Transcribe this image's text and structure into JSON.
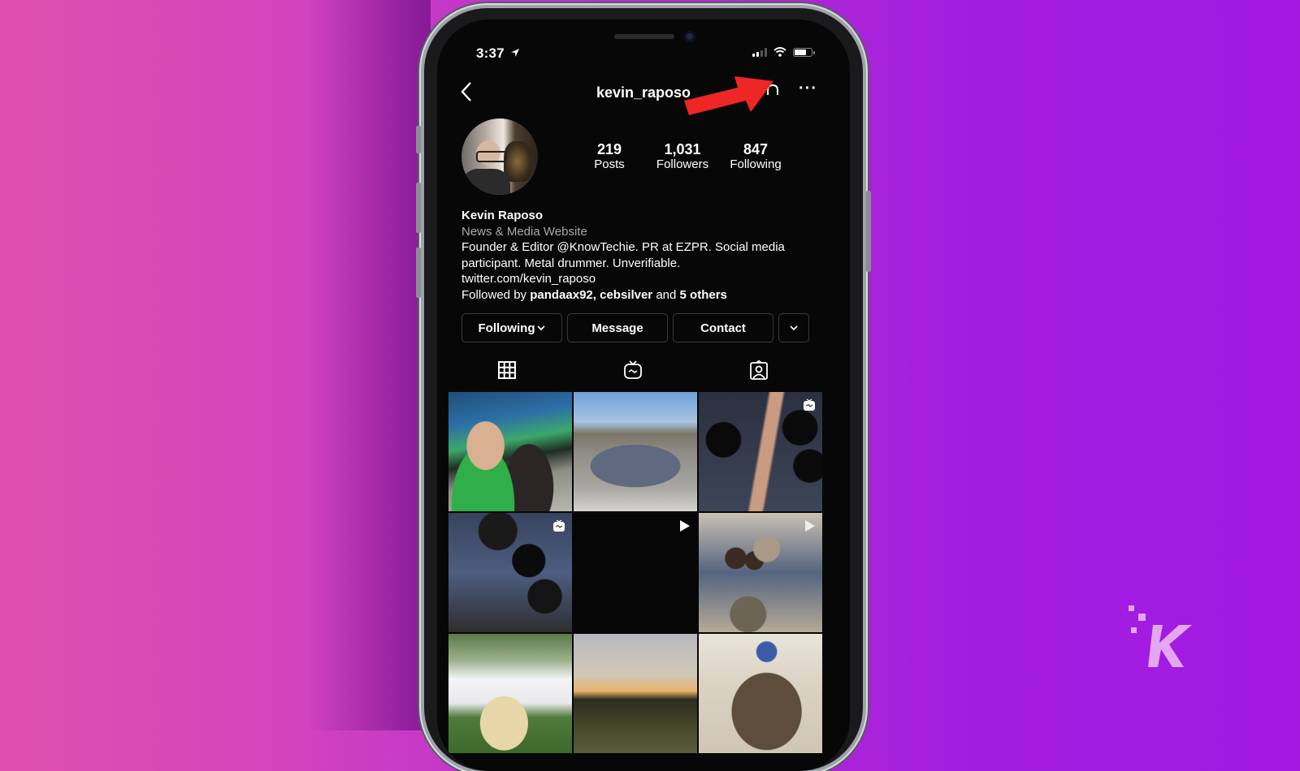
{
  "status_bar": {
    "time": "3:37",
    "location_icon": "location-arrow-icon",
    "signal_icon": "cellular-signal-icon",
    "wifi_icon": "wifi-icon",
    "battery_icon": "battery-icon",
    "battery_level": 0.7
  },
  "nav": {
    "back_icon": "chevron-left-icon",
    "username": "kevin_raposo",
    "bell_icon": "notification-bell-icon",
    "more_icon": "more-horizontal-icon",
    "back_glyph": "‹",
    "more_glyph": "···"
  },
  "profile": {
    "stats": [
      {
        "value": "219",
        "label": "Posts"
      },
      {
        "value": "1,031",
        "label": "Followers"
      },
      {
        "value": "847",
        "label": "Following"
      }
    ],
    "name": "Kevin Raposo",
    "category": "News & Media Website",
    "bio_line1": "Founder & Editor @KnowTechie. PR at EZPR. Social media",
    "bio_line2": "participant. Metal drummer. Unverifiable.",
    "link": "twitter.com/kevin_raposo",
    "followed_by_prefix": "Followed by ",
    "followed_by_users": "pandaax92, cebsilver",
    "followed_by_and": " and ",
    "followed_by_others": "5 others"
  },
  "buttons": {
    "following": "Following",
    "following_chevron": "⌄",
    "message": "Message",
    "contact": "Contact",
    "more_chevron": "⌄"
  },
  "tabs": [
    {
      "name": "grid",
      "icon": "grid-icon",
      "active": true
    },
    {
      "name": "igtv",
      "icon": "igtv-icon",
      "active": false
    },
    {
      "name": "tagged",
      "icon": "tagged-user-icon",
      "active": false
    }
  ],
  "grid_posts": [
    {
      "description": "Selfie at stadium with masks",
      "badge": null
    },
    {
      "description": "Grey car in parking lot",
      "badge": null
    },
    {
      "description": "Drummer overhead view",
      "badge": "igtv-icon"
    },
    {
      "description": "Drum kit overhead",
      "badge": "igtv-icon"
    },
    {
      "description": "Dark video",
      "badge": "play-icon"
    },
    {
      "description": "Drummer with electronic kit",
      "badge": "play-icon"
    },
    {
      "description": "Glass of drink outdoors",
      "badge": null
    },
    {
      "description": "Sunset field",
      "badge": null
    },
    {
      "description": "Tortoiseshell cat on chair",
      "badge": null
    }
  ],
  "annotation": {
    "arrow_color": "#ef2626",
    "arrow_target": "notification-bell"
  },
  "watermark": {
    "logo": "K",
    "color": "#e3a6f0"
  }
}
